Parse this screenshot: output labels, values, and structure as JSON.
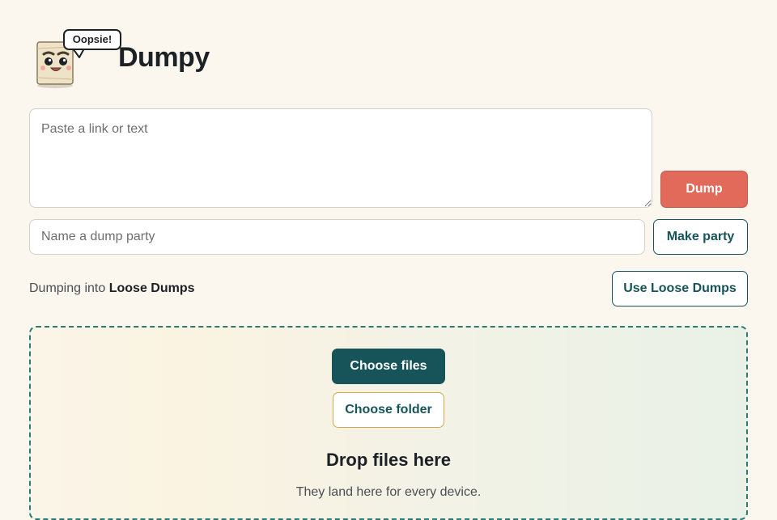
{
  "header": {
    "app_title": "Dumpy",
    "mascot_speech": "Oopsie!",
    "mascot_icon": "paper-mascot-icon"
  },
  "composer": {
    "text_placeholder": "Paste a link or text",
    "text_value": "",
    "dump_label": "Dump",
    "party_placeholder": "Name a dump party",
    "party_value": "",
    "make_party_label": "Make party"
  },
  "target": {
    "prefix": "Dumping into",
    "name": "Loose Dumps",
    "use_button_label": "Use Loose Dumps"
  },
  "dropzone": {
    "choose_files_label": "Choose files",
    "choose_folder_label": "Choose folder",
    "title": "Drop files here",
    "subtitle": "They land here for every device."
  },
  "colors": {
    "background": "#fbf7ef",
    "accent_teal": "#17545a",
    "dump_coral": "#e16a5b",
    "folder_border_gold": "#d6a84c"
  }
}
